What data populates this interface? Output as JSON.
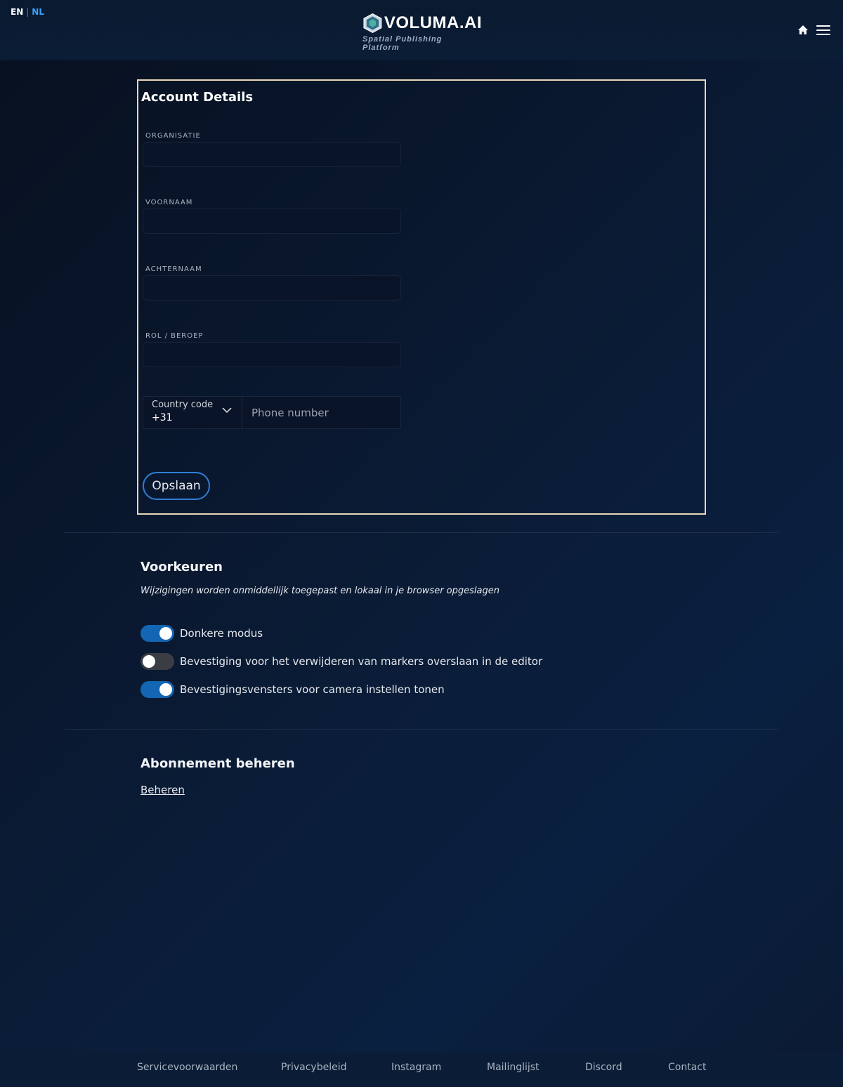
{
  "header": {
    "lang_en": "EN",
    "lang_sep": "|",
    "lang_nl": "NL",
    "logo_text": "VOLUMA.AI",
    "logo_tagline": "Spatial Publishing Platform",
    "accent_color": "#3aa0ff"
  },
  "account": {
    "title": "Account Details",
    "fields": [
      {
        "label": "ORGANISATIE",
        "value": ""
      },
      {
        "label": "VOORNAAM",
        "value": ""
      },
      {
        "label": "ACHTERNAAM",
        "value": ""
      },
      {
        "label": "ROL / BEROEP",
        "value": ""
      }
    ],
    "country_code_label": "Country code",
    "country_code_value": "+31",
    "phone_placeholder": "Phone number",
    "save_label": "Opslaan"
  },
  "preferences": {
    "title": "Voorkeuren",
    "subtitle": "Wijzigingen worden onmiddellijk toegepast en lokaal in je browser opgeslagen",
    "toggles": [
      {
        "label": "Donkere modus",
        "on": true
      },
      {
        "label": "Bevestiging voor het verwijderen van markers overslaan in de editor",
        "on": false
      },
      {
        "label": "Bevestigingsvensters voor camera instellen tonen",
        "on": true
      }
    ]
  },
  "subscription": {
    "title": "Abonnement beheren",
    "link": "Beheren"
  },
  "footer": {
    "links": [
      "Servicevoorwaarden",
      "Privacybeleid",
      "Instagram",
      "Mailinglijst",
      "Discord",
      "Contact"
    ]
  }
}
